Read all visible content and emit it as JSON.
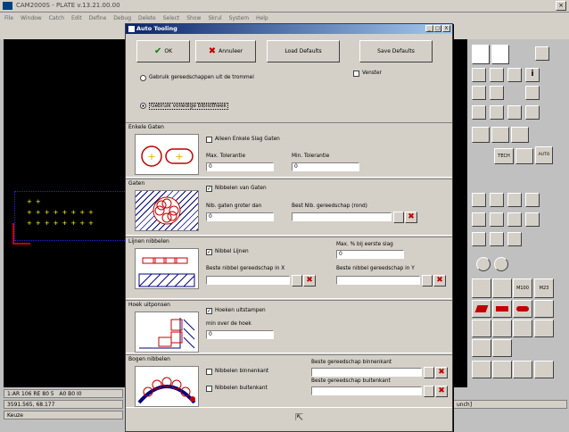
{
  "app": {
    "title": "CAM2000S - PLATE   v.13.21.00.00",
    "menu": [
      "File",
      "Window",
      "Catch",
      "Edit",
      "Define",
      "Debug",
      "Delete",
      "Select",
      "Show",
      "Skrul",
      "System",
      "Help"
    ]
  },
  "statusbar": {
    "line1": "1:AR 106 RE 80 5",
    "line1b": "A0  B0  I0",
    "coords": "3591.565,  68.177",
    "mode": "Keuze",
    "right": "unch]"
  },
  "dialog": {
    "title": "Auto Tooling",
    "ok": "OK",
    "cancel": "Annuleer",
    "load": "Load Defaults",
    "save": "Save Defaults",
    "opt_turret": "Gebruik gereedschappen uit de trommel",
    "opt_library": "Gebruik volledige bibliotheek",
    "window_label": "Venster",
    "sections": {
      "single": {
        "title": "Enkele Gaten",
        "cb": "Alleen Enkele Slag Gaten",
        "max_tol_label": "Max. Tolerantie",
        "max_tol": "0",
        "min_tol_label": "Min. Tolerantie",
        "min_tol": "0"
      },
      "holes": {
        "title": "Gaten",
        "cb": "Nibbelen van Gaten",
        "larger_label": "Nib. gaten groter dan",
        "larger": "0",
        "best_label": "Best Nib. gereedschap (rond)",
        "best": ""
      },
      "lines": {
        "title": "Lijnen nibbelen",
        "cb": "Nibbel Lijnen",
        "max_label": "Max. % bij eerste slag",
        "max": "0",
        "bestx_label": "Beste nibbel gereedschap in X",
        "bestx": "",
        "besty_label": "Beste nibbel gereedschap in Y",
        "besty": ""
      },
      "corner": {
        "title": "Hoek uitponsen",
        "cb": "Hoeken uitstampen",
        "min_label": "min over de hoek",
        "min": "0"
      },
      "arcs": {
        "title": "Bogen nibbelen",
        "cb_in": "Nibbelen binnenkant",
        "cb_out": "Nibbelen buitenkant",
        "best_in_label": "Beste gereedschap binnenkant",
        "best_in": "",
        "best_out_label": "Beste gereedschap buitenkant",
        "best_out": ""
      }
    },
    "title_buttons": [
      "_",
      "□",
      "X"
    ]
  },
  "rpanel": {
    "tech": "TECH",
    "auto": "AUTO",
    "m100": "M100",
    "m23": "M23"
  },
  "colors": {
    "accent": "#0a246a",
    "red": "#c00000",
    "green": "#008000",
    "canvas": "#000000"
  }
}
